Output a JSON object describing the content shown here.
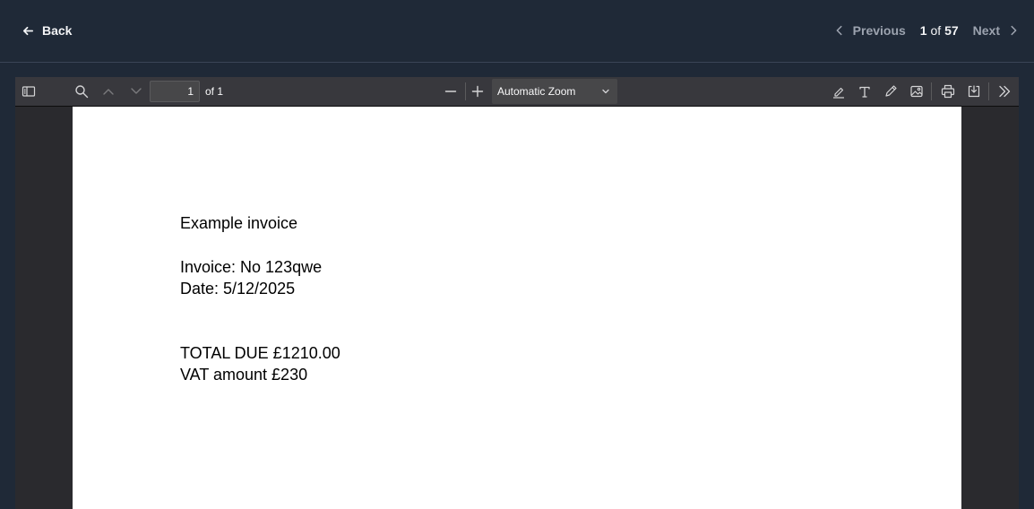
{
  "header": {
    "back_label": "Back",
    "prev_label": "Previous",
    "next_label": "Next",
    "current": "1",
    "of_word": "of",
    "total": "57"
  },
  "toolbar": {
    "page_value": "1",
    "of_pages": "of 1",
    "zoom_label": "Automatic Zoom",
    "icons": [
      "sidebar-toggle-icon",
      "search-icon",
      "chevron-up-icon",
      "chevron-down-icon",
      "minus-icon",
      "plus-icon",
      "highlight-icon",
      "text-icon",
      "draw-icon",
      "image-icon",
      "print-icon",
      "download-icon",
      "double-chevron-right-icon"
    ]
  },
  "document": {
    "title": "Example invoice",
    "invoice_no": "Invoice: No 123qwe",
    "date": "Date: 5/12/2025",
    "total_due": "TOTAL DUE £1210.00",
    "vat": "VAT amount £230"
  },
  "colors": {
    "app_bg": "#1f2937",
    "toolbar_bg": "#38383d",
    "viewer_bg": "#2a2a2e",
    "page_bg": "#ffffff"
  }
}
